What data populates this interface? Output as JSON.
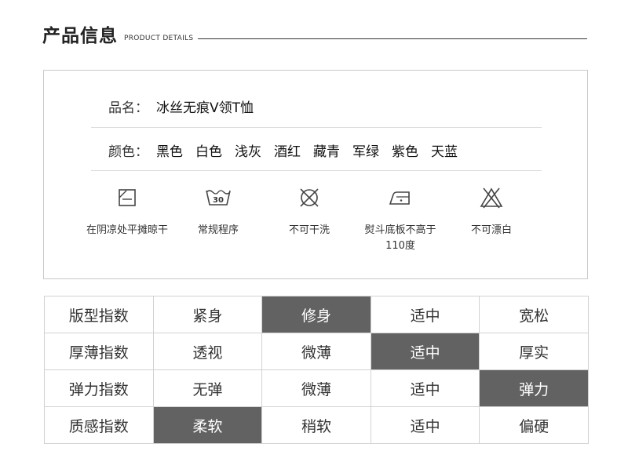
{
  "header": {
    "title": "产品信息",
    "subtitle": "PRODUCT DETAILS"
  },
  "info": {
    "name_label": "品名：",
    "name_value": "冰丝无痕V领T恤",
    "color_label": "颜色：",
    "colors": [
      "黑色",
      "白色",
      "浅灰",
      "酒红",
      "藏青",
      "军绿",
      "紫色",
      "天蓝"
    ]
  },
  "care": [
    {
      "icon": "shade-dry-flat-icon",
      "label": "在阴凉处平摊晾干"
    },
    {
      "icon": "wash-30-icon",
      "label": "常规程序"
    },
    {
      "icon": "no-dry-clean-icon",
      "label": "不可干洗"
    },
    {
      "icon": "iron-icon",
      "label": "熨斗底板不高于110度"
    },
    {
      "icon": "no-bleach-icon",
      "label": "不可漂白"
    }
  ],
  "index_table": {
    "active_color": "#626262",
    "rows": [
      {
        "label": "版型指数",
        "options": [
          "紧身",
          "修身",
          "适中",
          "宽松"
        ],
        "selected": "修身"
      },
      {
        "label": "厚薄指数",
        "options": [
          "透视",
          "微薄",
          "适中",
          "厚实"
        ],
        "selected": "适中"
      },
      {
        "label": "弹力指数",
        "options": [
          "无弹",
          "微薄",
          "适中",
          "弹力"
        ],
        "selected": "弹力"
      },
      {
        "label": "质感指数",
        "options": [
          "柔软",
          "稍软",
          "适中",
          "偏硬"
        ],
        "selected": "柔软"
      }
    ]
  }
}
